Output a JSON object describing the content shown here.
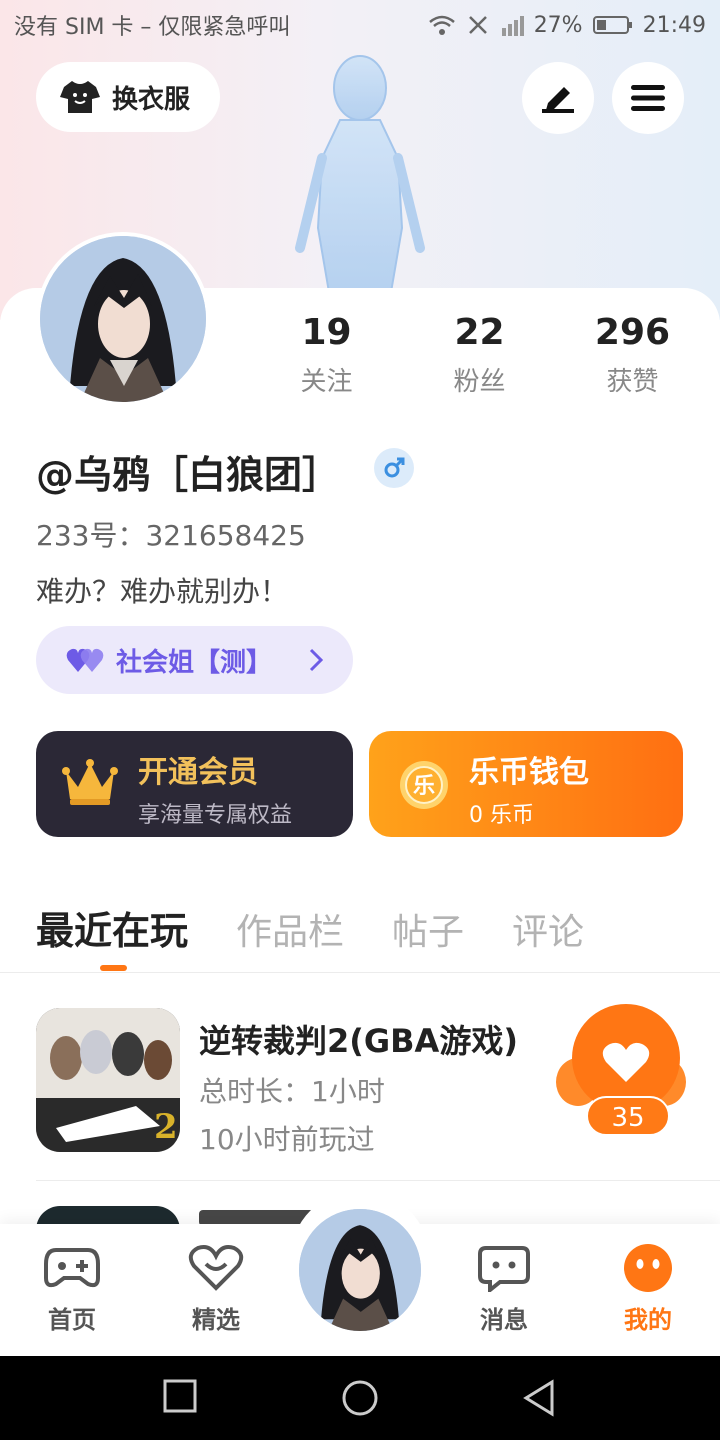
{
  "status_bar": {
    "carrier": "没有 SIM 卡 – 仅限紧急呼叫",
    "battery": "27%",
    "time": "21:49"
  },
  "header": {
    "outfit_label": "换衣服"
  },
  "profile": {
    "username": "@乌鸦［白狼团］",
    "id_line": "233号：321658425",
    "bio": "难办？难办就别办！",
    "tag_label": "社会姐【测】",
    "stats": [
      {
        "value": "19",
        "label": "关注"
      },
      {
        "value": "22",
        "label": "粉丝"
      },
      {
        "value": "296",
        "label": "获赞"
      }
    ]
  },
  "vip": {
    "title": "开通会员",
    "subtitle": "享海量专属权益"
  },
  "wallet": {
    "title": "乐币钱包",
    "subtitle": "0 乐币",
    "coin_glyph": "乐"
  },
  "tabs": [
    "最近在玩",
    "作品栏",
    "帖子",
    "评论"
  ],
  "games": [
    {
      "title": "逆转裁判2(GBA游戏)",
      "meta1": "总时长：1小时",
      "meta2": "10小时前玩过",
      "likes": "35"
    }
  ],
  "bottom_nav": [
    {
      "label": "首页",
      "icon": "gamepad-icon"
    },
    {
      "label": "精选",
      "icon": "heart-chat-icon"
    },
    {
      "label": "消息",
      "icon": "message-icon"
    },
    {
      "label": "我的",
      "icon": "face-icon"
    }
  ],
  "colors": {
    "accent": "#ff7614",
    "vip_gold": "#f2c15b",
    "tag_purple": "#6d5be6",
    "vip_bg": "#2b2836"
  }
}
